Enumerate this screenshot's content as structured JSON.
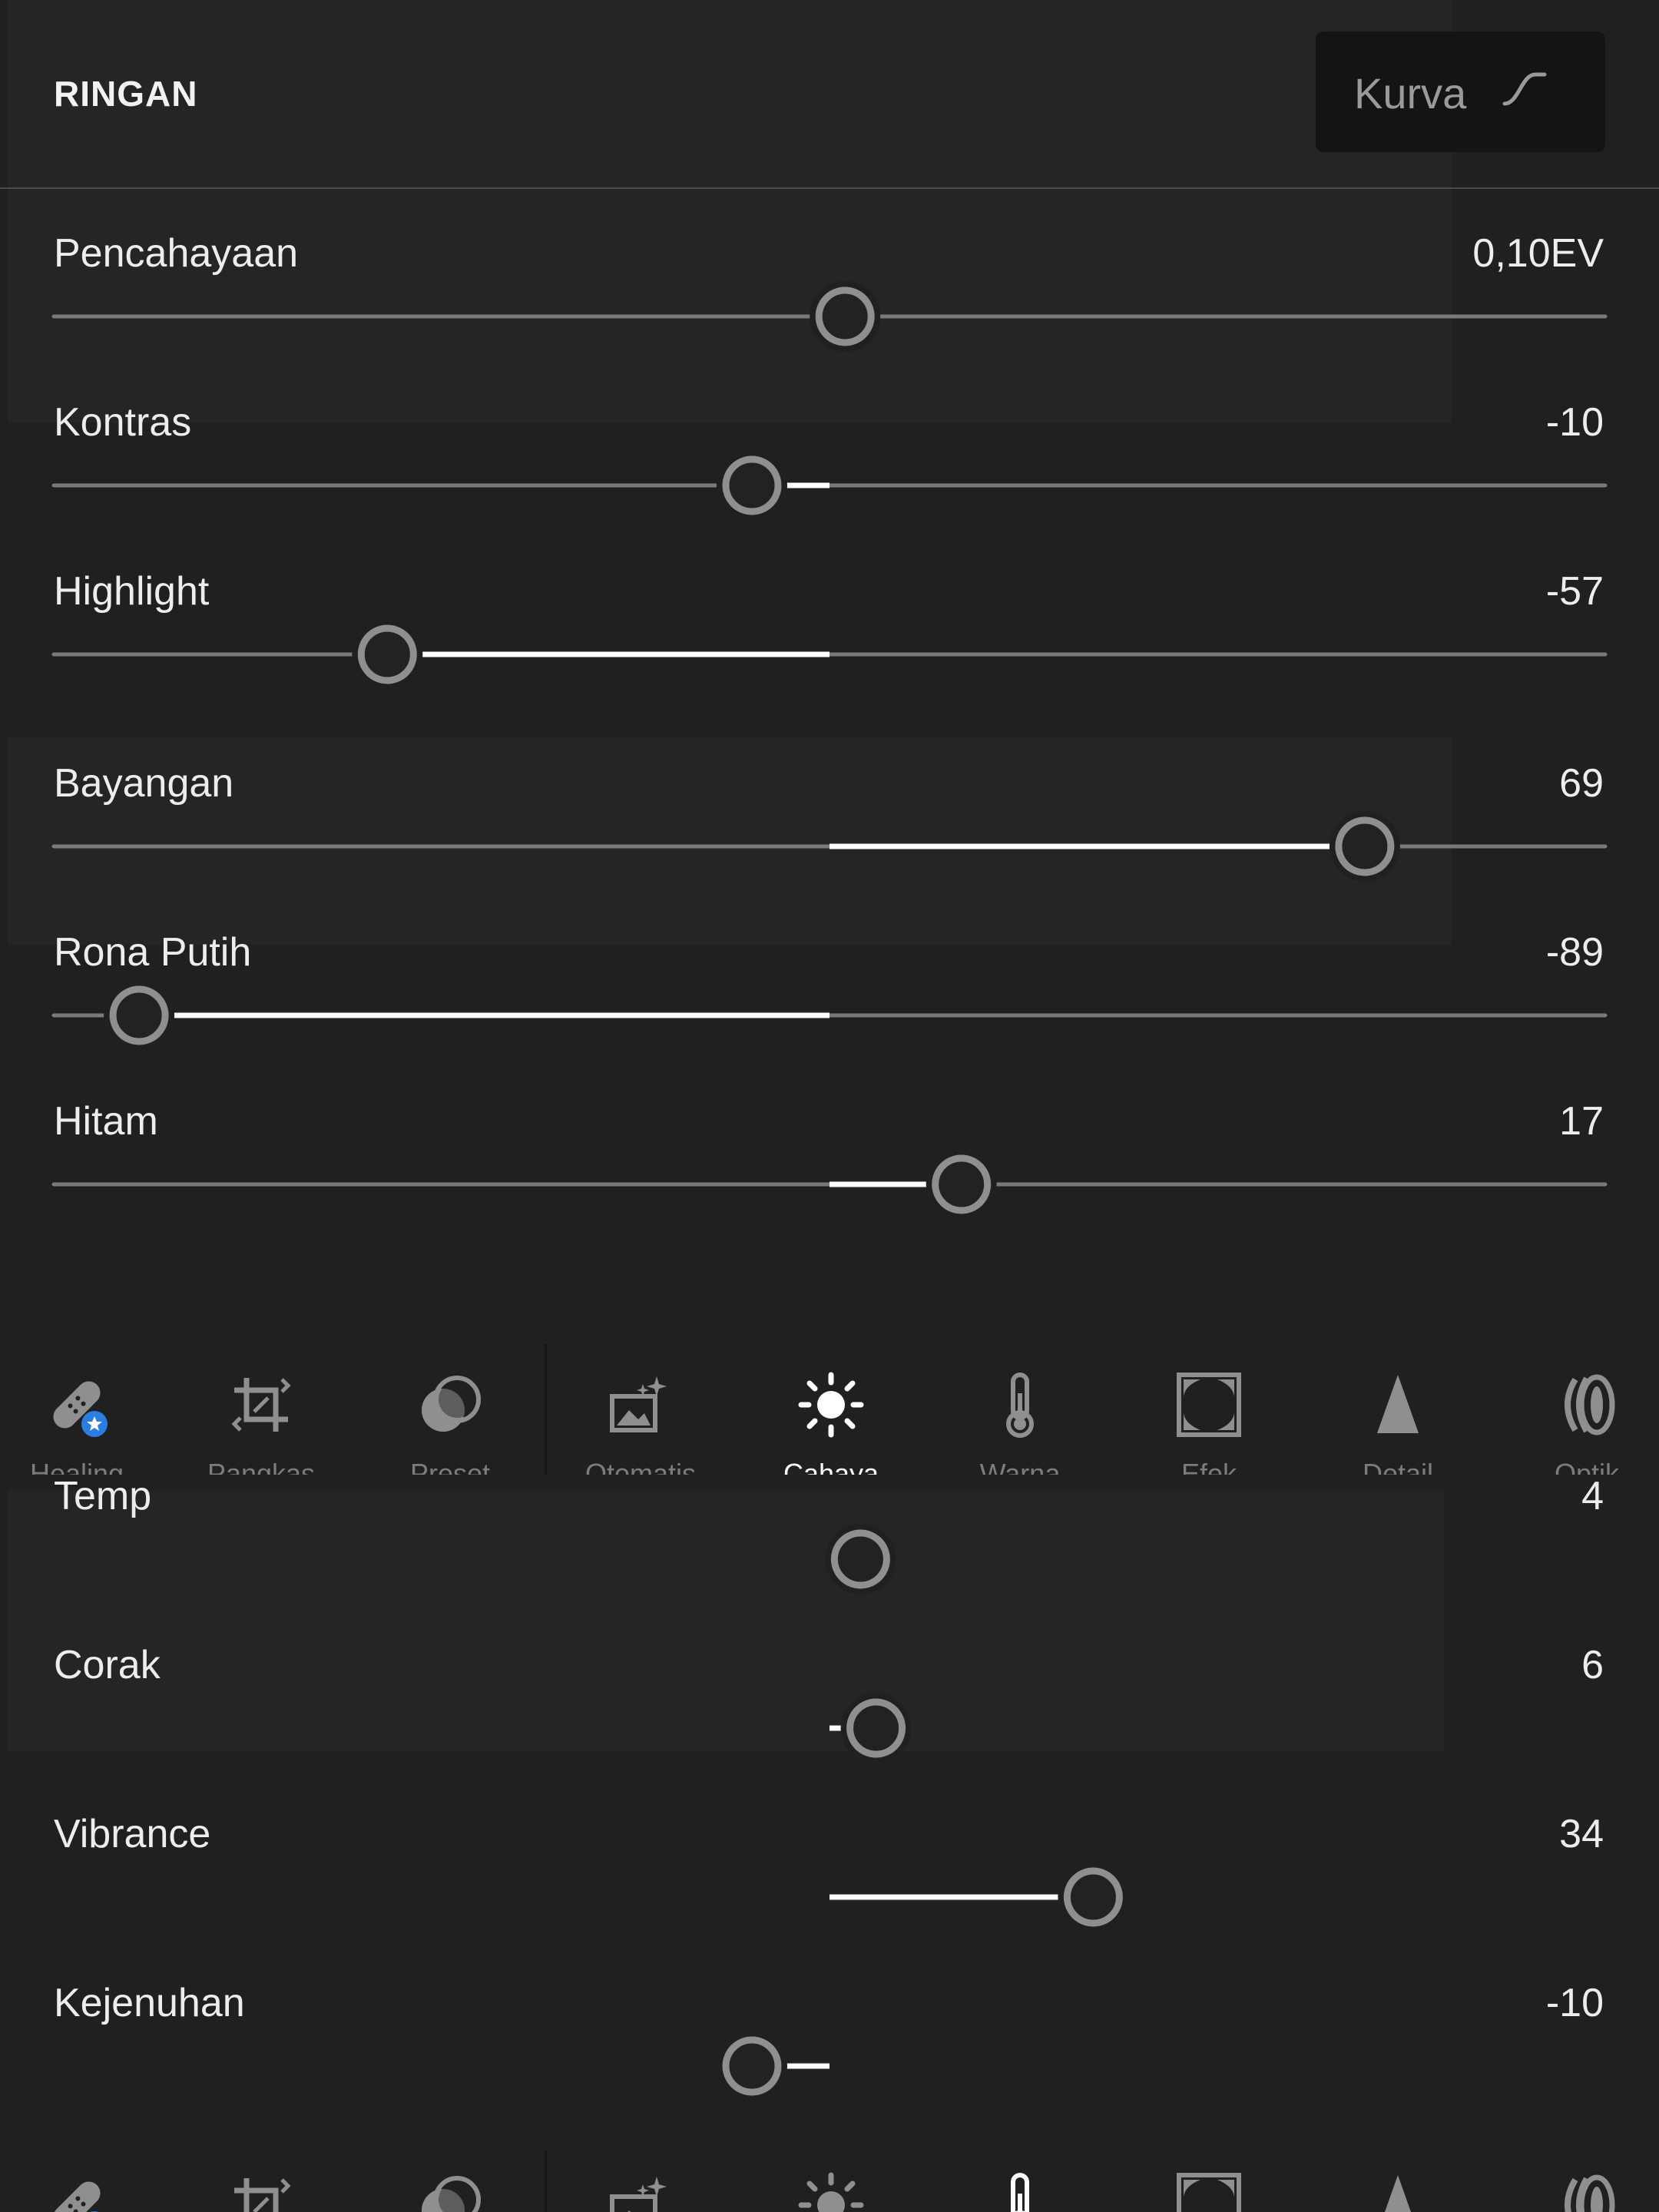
{
  "colors": {
    "background": "#202020",
    "track": "#7a7a7a",
    "active_fill": "#ffffff",
    "knob": "#8f8f8f",
    "inactive_icon": "#8f8f8f",
    "active_icon": "#ffffff",
    "healing_badge": "#2a7de1"
  },
  "header": {
    "title": "RINGAN",
    "curve_label": "Kurva"
  },
  "light_sliders": [
    {
      "label": "Pencahayaan",
      "value": "0,10EV",
      "position": 0.51,
      "fill": false
    },
    {
      "label": "Kontras",
      "value": "-10",
      "position": 0.45,
      "fill": true
    },
    {
      "label": "Highlight",
      "value": "-57",
      "position": 0.215,
      "fill": true
    },
    {
      "label": "Bayangan",
      "value": "69",
      "position": 0.845,
      "fill": true
    },
    {
      "label": "Rona Putih",
      "value": "-89",
      "position": 0.055,
      "fill": true
    },
    {
      "label": "Hitam",
      "value": "17",
      "position": 0.585,
      "fill": true
    }
  ],
  "toolbar": {
    "tools": [
      {
        "icon": "healing-icon",
        "label": "Healing"
      },
      {
        "icon": "crop-icon",
        "label": "Pangkas"
      },
      {
        "icon": "preset-icon",
        "label": "Preset"
      },
      {
        "icon": "auto-icon",
        "label": "Otomatis"
      },
      {
        "icon": "light-icon",
        "label": "Cahaya"
      },
      {
        "icon": "color-icon",
        "label": "Warna"
      },
      {
        "icon": "effects-icon",
        "label": "Efek"
      },
      {
        "icon": "detail-icon",
        "label": "Detail"
      },
      {
        "icon": "optics-icon",
        "label": "Optik"
      }
    ],
    "first_active_index": 4,
    "second_active_index": 5
  },
  "color_sliders": [
    {
      "label": "Temp",
      "value": "4",
      "position": 0.52
    },
    {
      "label": "Corak",
      "value": "6",
      "position": 0.53
    },
    {
      "label": "Vibrance",
      "value": "34",
      "position": 0.67
    },
    {
      "label": "Kejenuhan",
      "value": "-10",
      "position": 0.45
    }
  ]
}
